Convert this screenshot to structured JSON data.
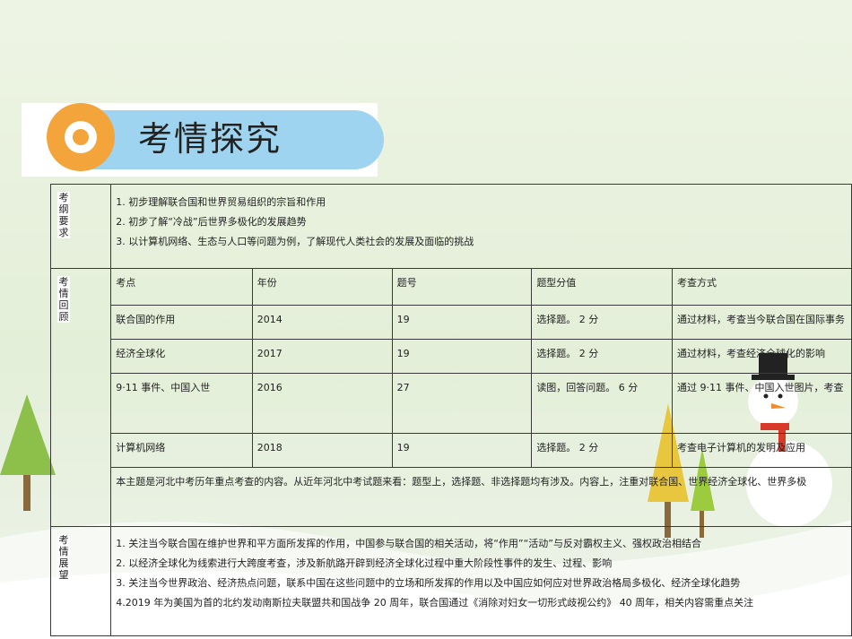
{
  "banner": {
    "title": "考情探究"
  },
  "sections": {
    "requirements": {
      "label": [
        "考",
        "纲",
        "要",
        "求"
      ],
      "items": [
        "1. 初步理解联合国和世界贸易组织的宗旨和作用",
        "2. 初步了解“冷战”后世界多极化的发展趋势",
        "3. 以计算机网络、生态与人口等问题为例，了解现代人类社会的发展及面临的挑战"
      ]
    },
    "review": {
      "label": [
        "考",
        "情",
        "回",
        "顾"
      ],
      "headers": [
        "考点",
        "年份",
        "题号",
        "题型分值",
        "考查方式"
      ],
      "rows": [
        [
          "联合国的作用",
          "2014",
          "19",
          "选择题。 2 分",
          "通过材料，考查当今联合国在国际事务"
        ],
        [
          "经济全球化",
          "2017",
          "19",
          "选择题。 2 分",
          "通过材料，考查经济全球化的影响"
        ],
        [
          "9·11 事件、中国入世",
          "2016",
          "27",
          "读图，回答问题。 6 分",
          "通过 9·11 事件、中国入世图片，考查"
        ],
        [
          "计算机网络",
          "2018",
          "19",
          "选择题。 2 分",
          "考查电子计算机的发明及应用"
        ]
      ],
      "summary": "本主题是河北中考历年重点考查的内容。从近年河北中考试题来看：题型上，选择题、非选择题均有涉及。内容上，注重对联合国、世界经济全球化、世界多极"
    },
    "outlook": {
      "label": [
        "考",
        "情",
        "展",
        "望"
      ],
      "items": [
        "1. 关注当今联合国在维护世界和平方面所发挥的作用，中国参与联合国的相关活动，将“作用”“活动”与反对霸权主义、强权政治相结合",
        "2. 以经济全球化为线索进行大跨度考查，涉及新航路开辟到经济全球化过程中重大阶段性事件的发生、过程、影响",
        "3. 关注当今世界政治、经济热点问题，联系中国在这些问题中的立场和所发挥的作用以及中国应如何应对世界政治格局多极化、经济全球化趋势",
        "4.2019 年为美国为首的北约发动南斯拉夫联盟共和国战争 20 周年，联合国通过《消除对妇女一切形式歧视公约》 40 周年，相关内容需重点关注"
      ]
    }
  }
}
